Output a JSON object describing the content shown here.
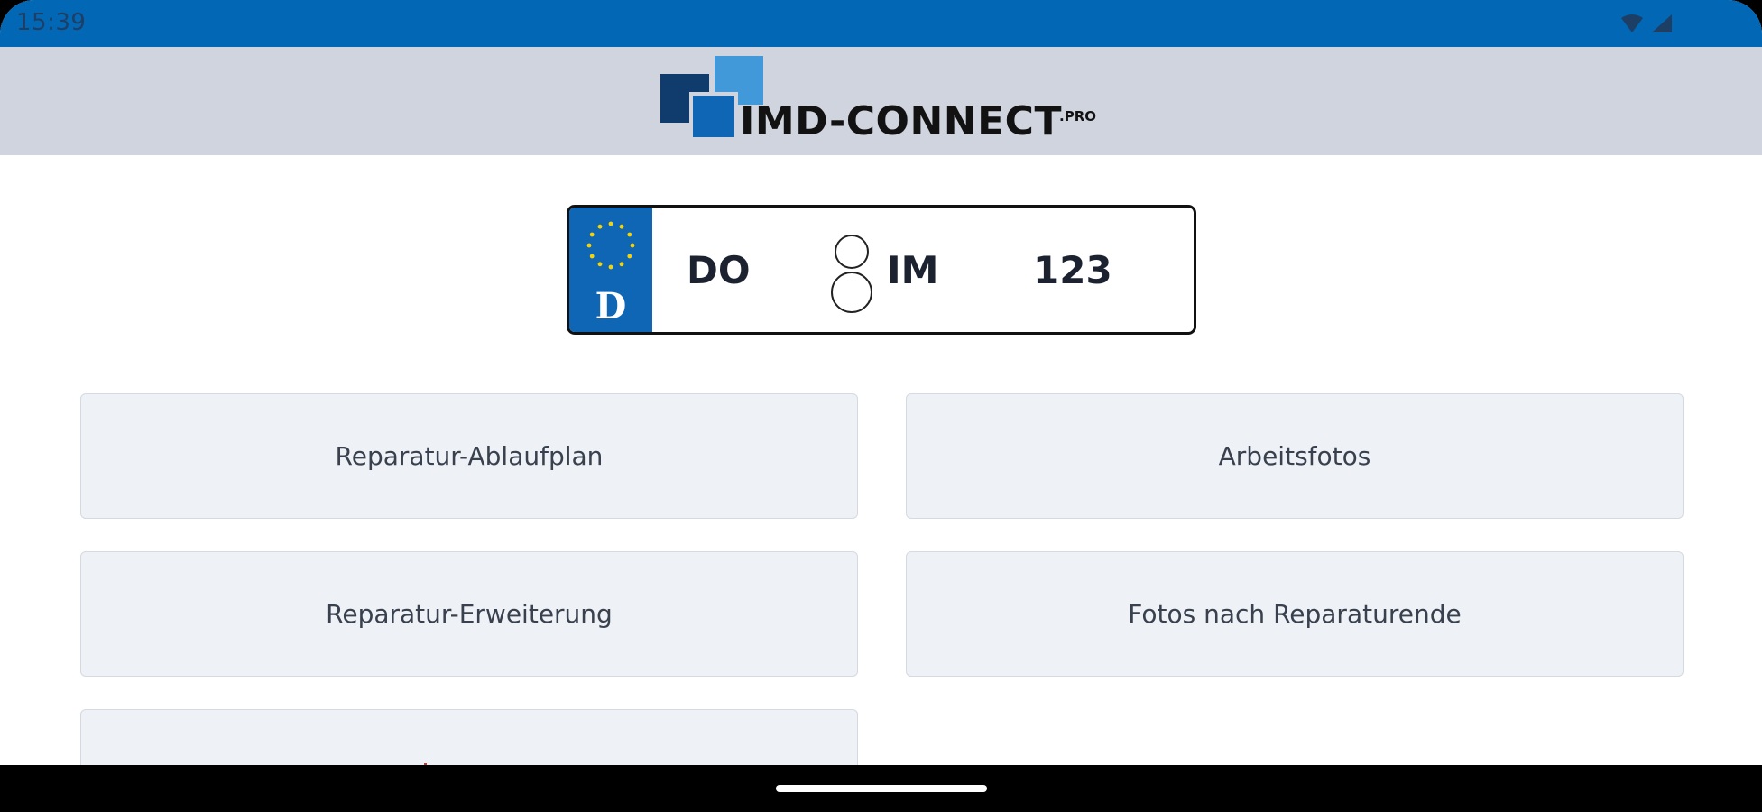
{
  "status_bar": {
    "time": "15:39",
    "icons": [
      "wifi-icon",
      "cell-signal-icon"
    ],
    "color": "#0267b5"
  },
  "header": {
    "logo_text": "IMD-CONNECT",
    "logo_suffix": ".PRO",
    "background": "#d0d4de"
  },
  "license_plate": {
    "country_code": "D",
    "district": "DO",
    "letters": "IM",
    "number": "123",
    "eu_band_color": "#0f66b4"
  },
  "menu": {
    "items": [
      {
        "label": "Reparatur-Ablaufplan"
      },
      {
        "label": "Arbeitsfotos"
      },
      {
        "label": "Reparatur-Erweiterung"
      },
      {
        "label": "Fotos nach Reparaturende"
      },
      {
        "label": ""
      }
    ]
  },
  "navigation_bar": {
    "gesture_handle": "home-handle"
  }
}
